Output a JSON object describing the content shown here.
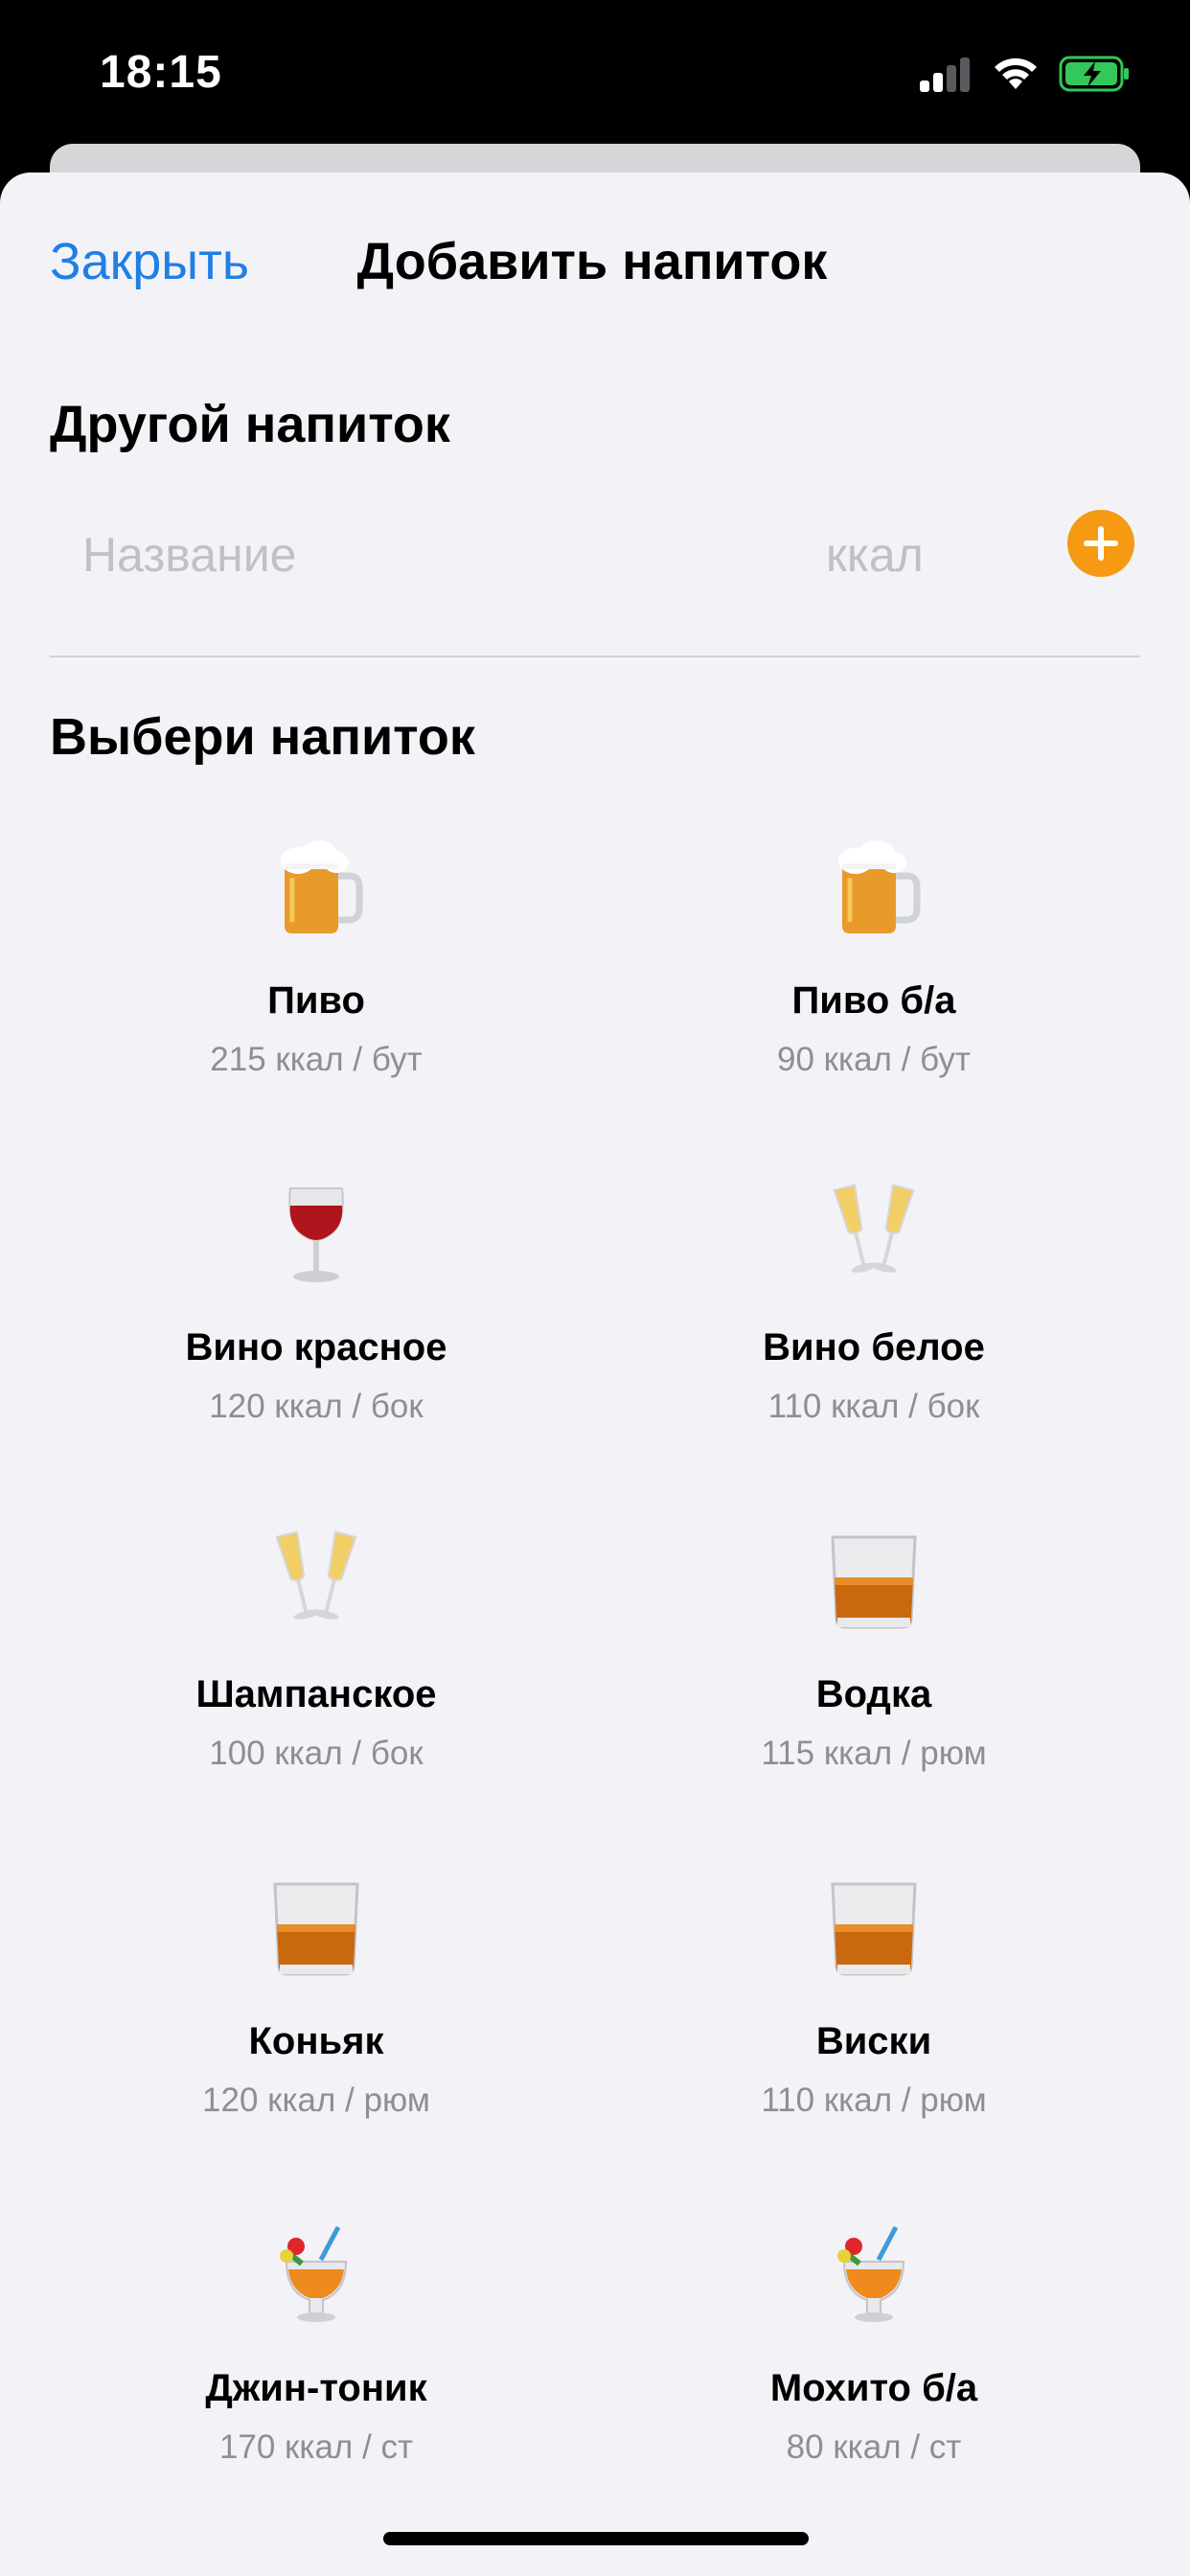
{
  "status_bar": {
    "time": "18:15",
    "signal_icon": "cellular-signal-icon",
    "wifi_icon": "wifi-icon",
    "battery_icon": "battery-charging-icon",
    "battery_color": "#34c759"
  },
  "nav": {
    "close_label": "Закрыть",
    "title": "Добавить напиток",
    "accent_color": "#1f7fe5"
  },
  "custom_drink": {
    "section_title": "Другой напиток",
    "name_placeholder": "Название",
    "name_value": "",
    "kcal_placeholder": "ккал",
    "kcal_value": "",
    "add_icon": "plus-circle-icon",
    "add_color": "#f59a12"
  },
  "choose": {
    "section_title": "Выбери напиток",
    "drinks": [
      {
        "name": "Пиво",
        "kcal": "215 ккал / бут",
        "icon": "beer-mug-icon"
      },
      {
        "name": "Пиво б/а",
        "kcal": "90 ккал / бут",
        "icon": "beer-mug-icon"
      },
      {
        "name": "Вино красное",
        "kcal": "120 ккал / бок",
        "icon": "wine-glass-icon"
      },
      {
        "name": "Вино белое",
        "kcal": "110 ккал / бок",
        "icon": "clinking-glasses-icon"
      },
      {
        "name": "Шампанское",
        "kcal": "100 ккал / бок",
        "icon": "clinking-glasses-icon"
      },
      {
        "name": "Водка",
        "kcal": "115 ккал / рюм",
        "icon": "tumbler-glass-icon"
      },
      {
        "name": "Коньяк",
        "kcal": "120 ккал / рюм",
        "icon": "tumbler-glass-icon"
      },
      {
        "name": "Виски",
        "kcal": "110 ккал / рюм",
        "icon": "tumbler-glass-icon"
      },
      {
        "name": "Джин-тоник",
        "kcal": "170 ккал / ст",
        "icon": "tropical-drink-icon"
      },
      {
        "name": "Мохито б/а",
        "kcal": "80 ккал / ст",
        "icon": "tropical-drink-icon"
      }
    ]
  }
}
